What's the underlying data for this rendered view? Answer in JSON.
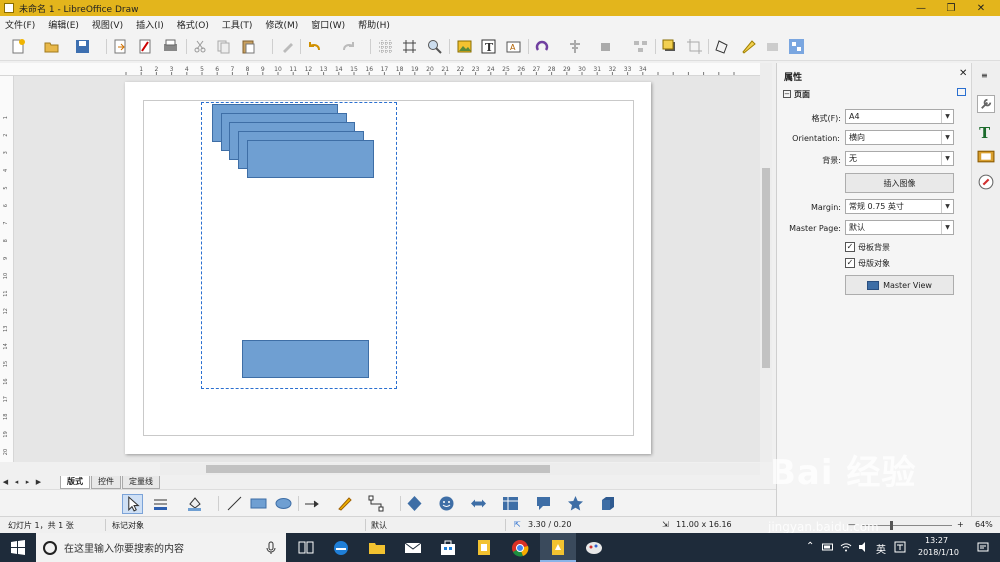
{
  "window": {
    "title": "未命名 1 - LibreOffice Draw"
  },
  "menu": [
    "文件(F)",
    "编辑(E)",
    "视图(V)",
    "插入(I)",
    "格式(O)",
    "工具(T)",
    "修改(M)",
    "窗口(W)",
    "帮助(H)"
  ],
  "ruler_labels": [
    "1",
    "2",
    "3",
    "4",
    "5",
    "6",
    "7",
    "8",
    "9",
    "10",
    "11",
    "12",
    "13",
    "14",
    "15",
    "16",
    "17",
    "18",
    "19",
    "20",
    "21",
    "22",
    "23",
    "24",
    "25",
    "26",
    "27",
    "28",
    "29",
    "30",
    "31",
    "32",
    "33",
    "34"
  ],
  "vruler_labels": [
    "1",
    "2",
    "3",
    "4",
    "5",
    "6",
    "7",
    "8",
    "9",
    "10",
    "11",
    "12",
    "13",
    "14",
    "15",
    "16",
    "17",
    "18",
    "19",
    "20"
  ],
  "tabs": {
    "layout": "版式",
    "controls": "控件",
    "dimension": "定量线"
  },
  "status": {
    "slide": "幻灯片 1，共 1 张",
    "mode": "标记对象",
    "master": "默认",
    "position": "3.30 / 0.20",
    "size": "11.00 x 16.16",
    "zoom": "64%"
  },
  "sidebar": {
    "title": "属性",
    "section": "页面",
    "format_label": "格式(F):",
    "format_value": "A4",
    "orientation_label": "Orientation:",
    "orientation_value": "横向",
    "background_label": "背景:",
    "background_value": "无",
    "insert_image": "插入图像",
    "margin_label": "Margin:",
    "margin_value": "常规 0.75 英寸",
    "master_page_label": "Master Page:",
    "master_page_value": "默认",
    "master_bg": "母板背景",
    "master_obj": "母版对象",
    "master_view": "Master View"
  },
  "taskbar": {
    "search_placeholder": "在这里输入你要搜索的内容",
    "ime": "英",
    "time": "13:27",
    "date": "2018/1/10"
  },
  "watermark": {
    "brand": "Bai 经验",
    "url": "jingyan.baidu.com"
  },
  "colors": {
    "title_bar": "#e3b51c",
    "shape_fill": "#6f9fd2",
    "shape_border": "#3e6ea6",
    "selection": "#2a6fd0"
  }
}
